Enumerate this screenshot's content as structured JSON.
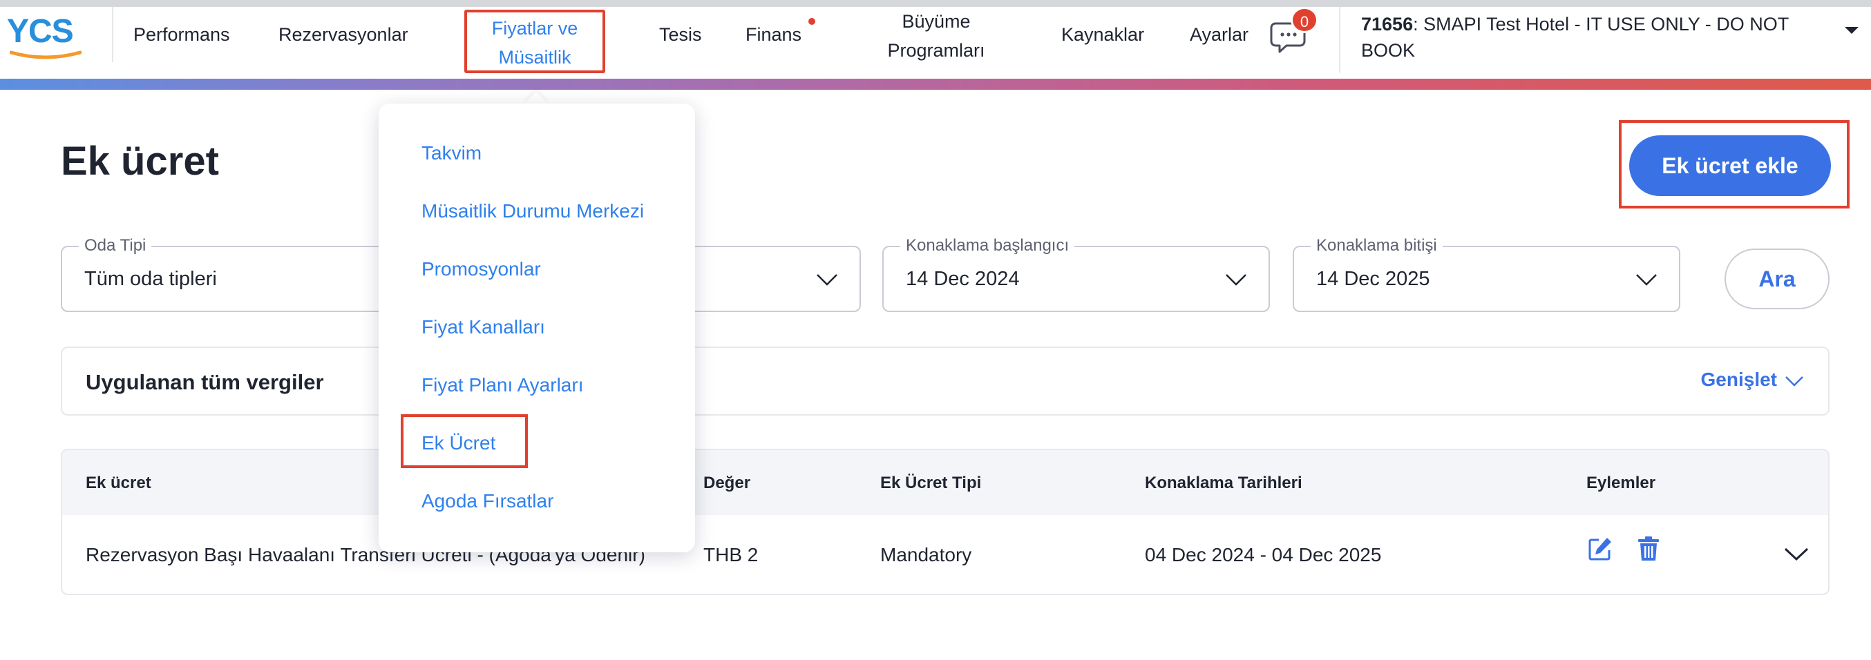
{
  "nav": {
    "logo": "YCS",
    "items": [
      {
        "label": "Performans"
      },
      {
        "label": "Rezervasyonlar"
      },
      {
        "label": "Fiyatlar ve Müsaitlik"
      },
      {
        "label": "Tesis"
      },
      {
        "label": "Finans"
      },
      {
        "label": "Büyüme Programları"
      },
      {
        "label": "Kaynaklar"
      },
      {
        "label": "Ayarlar"
      }
    ],
    "chat_badge_count": "0",
    "hotel_id": "71656",
    "hotel_name": ": SMAPI Test Hotel - IT USE ONLY - DO NOT BOOK"
  },
  "dropdown": {
    "items": [
      {
        "label": "Takvim"
      },
      {
        "label": "Müsaitlik Durumu Merkezi"
      },
      {
        "label": "Promosyonlar"
      },
      {
        "label": "Fiyat Kanalları"
      },
      {
        "label": "Fiyat Planı Ayarları"
      },
      {
        "label": "Ek Ücret"
      },
      {
        "label": "Agoda Fırsatlar"
      }
    ]
  },
  "page": {
    "title": "Ek ücret",
    "add_button": "Ek ücret ekle"
  },
  "filters": {
    "room_type": {
      "label": "Oda Tipi",
      "value": "Tüm oda tipleri"
    },
    "stay_start": {
      "label": "Konaklama başlangıcı",
      "value": "14 Dec 2024"
    },
    "stay_end": {
      "label": "Konaklama bitişi",
      "value": "14 Dec 2025"
    },
    "search_button": "Ara"
  },
  "taxes": {
    "title": "Uygulanan tüm vergiler",
    "expand_label": "Genişlet"
  },
  "table": {
    "headers": [
      "Ek ücret",
      "Değer",
      "Ek Ücret Tipi",
      "Konaklama Tarihleri",
      "Eylemler"
    ],
    "rows": [
      {
        "name": "Rezervasyon Başı Havaalanı Transferi Ücreti - (Agoda'ya Ödenir)",
        "value": "THB 2",
        "type": "Mandatory",
        "dates": "04 Dec 2024 - 04 Dec 2025"
      }
    ]
  },
  "colors": {
    "accent": "#3a72e6",
    "link": "#2f80ed",
    "highlight_frame": "#e0412f",
    "badge": "#e0412f"
  }
}
